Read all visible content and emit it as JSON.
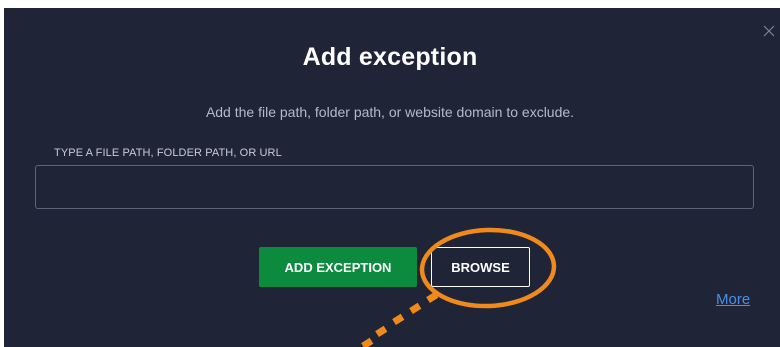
{
  "dialog": {
    "title": "Add exception",
    "subtitle": "Add the file path, folder path, or website domain to exclude.",
    "field_label": "TYPE A FILE PATH, FOLDER PATH, OR URL",
    "field_value": "",
    "add_button_label": "ADD EXCEPTION",
    "browse_button_label": "BROWSE",
    "more_link": "More",
    "close_icon": "close-icon"
  },
  "annotation": {
    "highlight_target": "browse-button",
    "color": "#f08a1c"
  },
  "colors": {
    "background": "#1f2437",
    "accent_green": "#0c8a3e",
    "link_blue": "#4b8ee6",
    "annotation_orange": "#f08a1c"
  }
}
